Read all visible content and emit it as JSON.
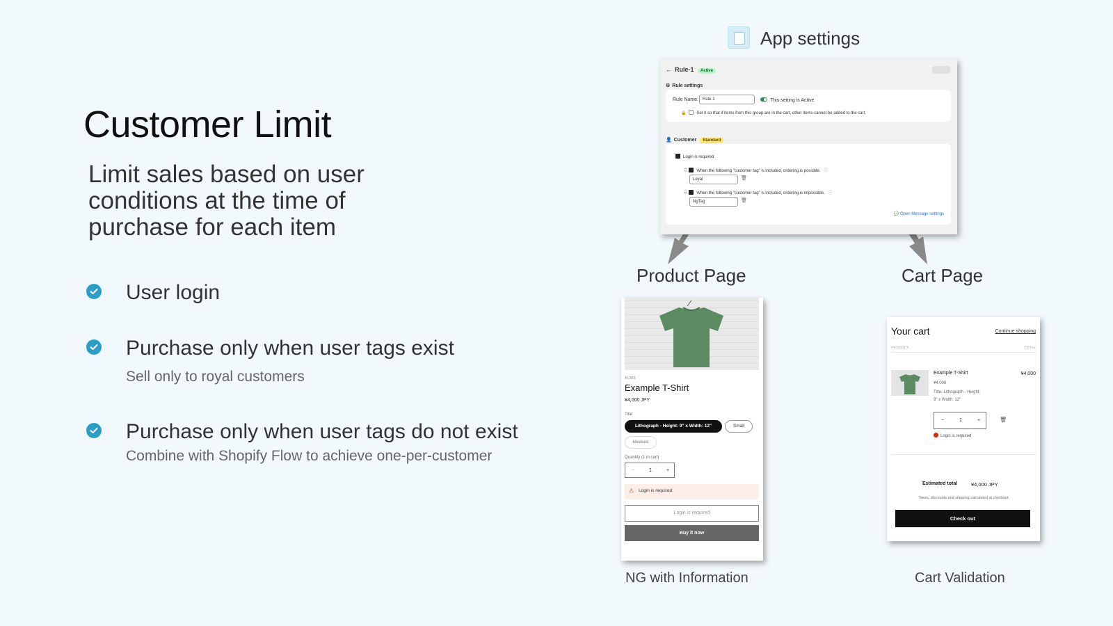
{
  "left": {
    "title": "Customer Limit",
    "subtitle": "Limit sales based on user conditions at the time of purchase for each item",
    "features": [
      {
        "title": "User login",
        "note": ""
      },
      {
        "title": "Purchase only when user tags exist",
        "note": "Sell only to royal customers"
      },
      {
        "title": "Purchase only when user tags do not exist",
        "note": "Combine with Shopify Flow to achieve one-per-customer"
      }
    ]
  },
  "sections": {
    "app_settings": "App settings",
    "product_page": "Product Page",
    "cart_page": "Cart Page",
    "product_caption": "NG with Information",
    "cart_caption": "Cart Validation"
  },
  "settings": {
    "back_arrow": "←",
    "rule_title": "Rule-1",
    "status_badge": "Active",
    "rule_settings_heading": "Rule settings",
    "rule_name_label": "Rule Name:",
    "rule_name_value": "Rule-1",
    "active_text": "This setting is Active",
    "group_text": "Set it so that if items from this group are in the cart, other items cannot be added to the cart.",
    "customer_heading": "Customer",
    "customer_badge": "Standard",
    "login_required": "Login is required",
    "tag_allow_text": "When the following \"customer tag\" is included, ordering is possible.",
    "tag_allow_value": "Loyal",
    "tag_deny_text": "When the following \"customer tag\" is included, ordering is impossible.",
    "tag_deny_value": "NgTag",
    "message_link": "Open Message settings"
  },
  "product": {
    "vendor": "ACME",
    "name": "Example T-Shirt",
    "price": "¥4,000 JPY",
    "option_label": "Title",
    "options": [
      "Lithograph - Height: 9\" x Width: 12\"",
      "Small",
      "Medium"
    ],
    "quantity_label": "Quantity (1 in cart)",
    "quantity": "1",
    "minus": "−",
    "plus": "+",
    "error": "Login is required",
    "add_button": "Login is required",
    "buy_button": "Buy it now"
  },
  "cart": {
    "title": "Your cart",
    "continue": "Continue shopping",
    "col_product": "PRODUCT",
    "col_total": "TOTAL",
    "item_name": "Example T-Shirt",
    "item_price": "¥4,000",
    "item_total": "¥4,000",
    "item_variant_1": "Title: Lithograph - Height:",
    "item_variant_2": "9\" x Width: 12\"",
    "quantity": "1",
    "minus": "−",
    "plus": "+",
    "error": "Login is required",
    "estimated_label": "Estimated total",
    "estimated_value": "¥4,000 JPY",
    "tax_note": "Taxes, discounts and shipping calculated at checkout",
    "checkout": "Check out"
  },
  "colors": {
    "background": "#f2f9fd",
    "check_icon": "#2a9ec6",
    "shirt": "#5c8a63",
    "error_red": "#d72c0d"
  }
}
